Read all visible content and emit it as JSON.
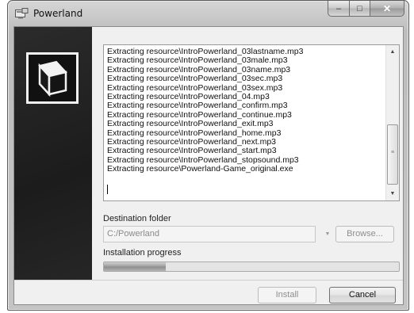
{
  "window": {
    "title": "Powerland",
    "minimize_glyph": "‒",
    "maximize_glyph": "□",
    "close_glyph": "✕"
  },
  "log": {
    "lines": [
      "Extracting resource\\IntroPowerland_03lastname.mp3",
      "Extracting resource\\IntroPowerland_03male.mp3",
      "Extracting resource\\IntroPowerland_03name.mp3",
      "Extracting resource\\IntroPowerland_03sec.mp3",
      "Extracting resource\\IntroPowerland_03sex.mp3",
      "Extracting resource\\IntroPowerland_04.mp3",
      "Extracting resource\\IntroPowerland_confirm.mp3",
      "Extracting resource\\IntroPowerland_continue.mp3",
      "Extracting resource\\IntroPowerland_exit.mp3",
      "Extracting resource\\IntroPowerland_home.mp3",
      "Extracting resource\\IntroPowerland_next.mp3",
      "Extracting resource\\IntroPowerland_start.mp3",
      "Extracting resource\\IntroPowerland_stopsound.mp3",
      "Extracting resource\\Powerland-Game_original.exe"
    ]
  },
  "destination": {
    "label": "Destination folder",
    "value": "C:/Powerland",
    "browse_label": "Browse..."
  },
  "progress": {
    "label": "Installation progress",
    "fraction": 0.21
  },
  "footer": {
    "install_label": "Install",
    "cancel_label": "Cancel"
  },
  "icons": {
    "app": "installer-icon",
    "logo": "cube-box-icon"
  },
  "colors": {
    "sidebar": "#222222",
    "progress_fill": "#9c9c9c"
  }
}
